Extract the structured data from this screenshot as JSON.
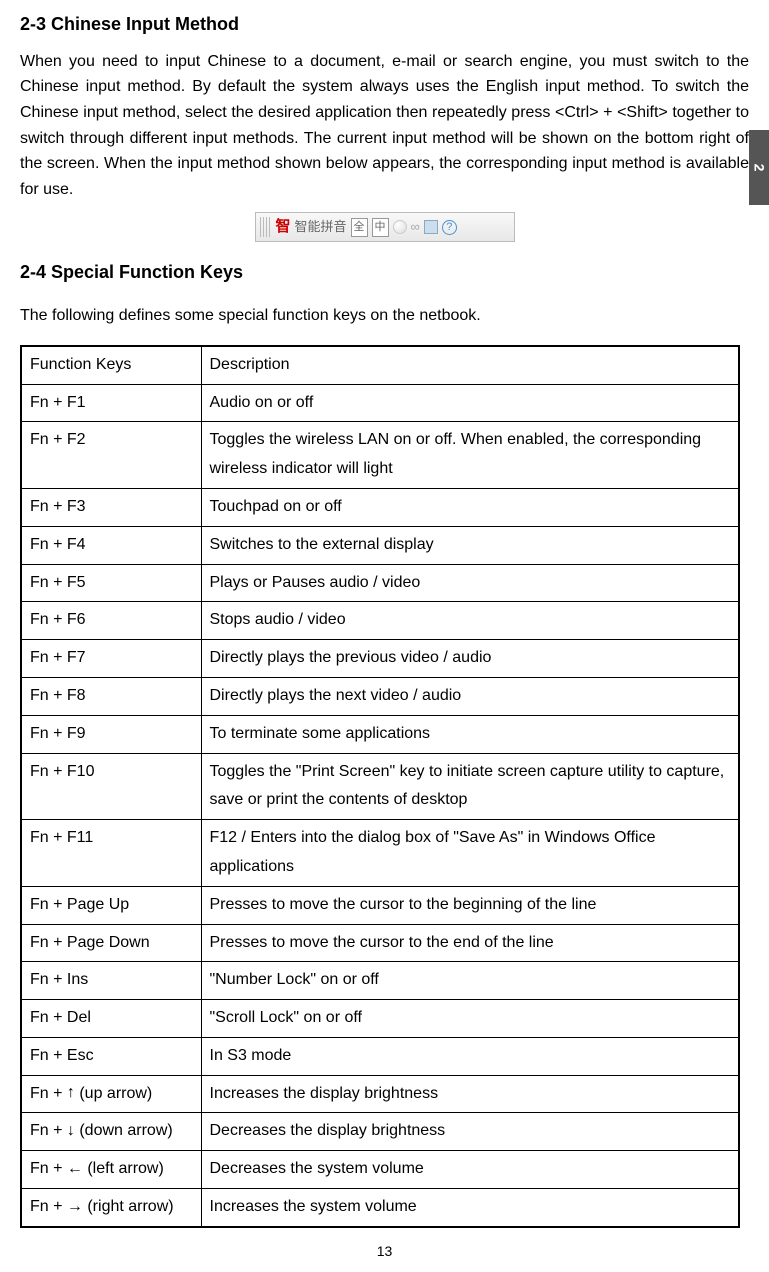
{
  "side_tab": "2",
  "page_number": "13",
  "sections": {
    "s23_heading": "2-3 Chinese Input Method",
    "s23_body": "When you need to input Chinese to a document, e-mail or search engine, you must switch to the Chinese input method. By default the system always uses the English input method. To switch the Chinese input method, select the desired application then repeatedly press <Ctrl> + <Shift> together to switch through different input methods. The current input method will be shown on the bottom right of the screen. When the input method shown below appears, the corresponding input method is available for use.",
    "s24_heading": "2-4  Special Function Keys",
    "s24_intro": "The following defines some special function keys on the netbook."
  },
  "ime_bar": {
    "zhi": "智",
    "label": "智能拼音",
    "quan": "全",
    "zhong": "中",
    "help": "?"
  },
  "table": {
    "header": {
      "key": "Function Keys",
      "desc": "Description"
    },
    "rows": [
      {
        "key": "Fn + F1",
        "desc": "Audio on or off"
      },
      {
        "key": "Fn + F2",
        "desc": "Toggles the wireless LAN on or off. When enabled, the corresponding wireless indicator will light"
      },
      {
        "key": "Fn + F3",
        "desc": "Touchpad on or off"
      },
      {
        "key": "Fn + F4",
        "desc": "Switches to the external display"
      },
      {
        "key": "Fn + F5",
        "desc": "Plays or Pauses audio / video"
      },
      {
        "key": "Fn + F6",
        "desc": "Stops audio / video"
      },
      {
        "key": "Fn + F7",
        "desc": "Directly plays the previous video / audio"
      },
      {
        "key": "Fn + F8",
        "desc": "Directly plays the next video / audio"
      },
      {
        "key": "Fn + F9",
        "desc": "To terminate some applications"
      },
      {
        "key": "Fn + F10",
        "desc": "Toggles the \"Print Screen\" key to initiate screen capture utility to capture, save or print the contents of desktop"
      },
      {
        "key": "Fn + F11",
        "desc": "F12 / Enters into the dialog box of \"Save As\" in Windows Office applications"
      },
      {
        "key": "Fn + Page Up",
        "desc": "Presses to move the cursor to the beginning of the line"
      },
      {
        "key": "Fn + Page Down",
        "desc": "Presses to move the cursor to the end of the line"
      },
      {
        "key": "Fn + Ins",
        "desc": "\"Number Lock\" on or off"
      },
      {
        "key": "Fn + Del",
        "desc": "\"Scroll Lock\" on or off"
      },
      {
        "key": "Fn + Esc",
        "desc": "In S3 mode"
      },
      {
        "key_prefix": "Fn +",
        "arrow": "↑",
        "key_suffix": "(up arrow)",
        "desc": "Increases the display brightness"
      },
      {
        "key_prefix": "Fn +",
        "arrow": "↓",
        "key_suffix": "(down arrow)",
        "desc": "Decreases the display brightness"
      },
      {
        "key_prefix": "Fn +",
        "arrow": "←",
        "key_suffix": "(left arrow)",
        "desc": "Decreases the system volume"
      },
      {
        "key_prefix": "Fn +",
        "arrow": "→",
        "key_suffix": "(right arrow)",
        "desc": "Increases the system volume"
      }
    ]
  }
}
